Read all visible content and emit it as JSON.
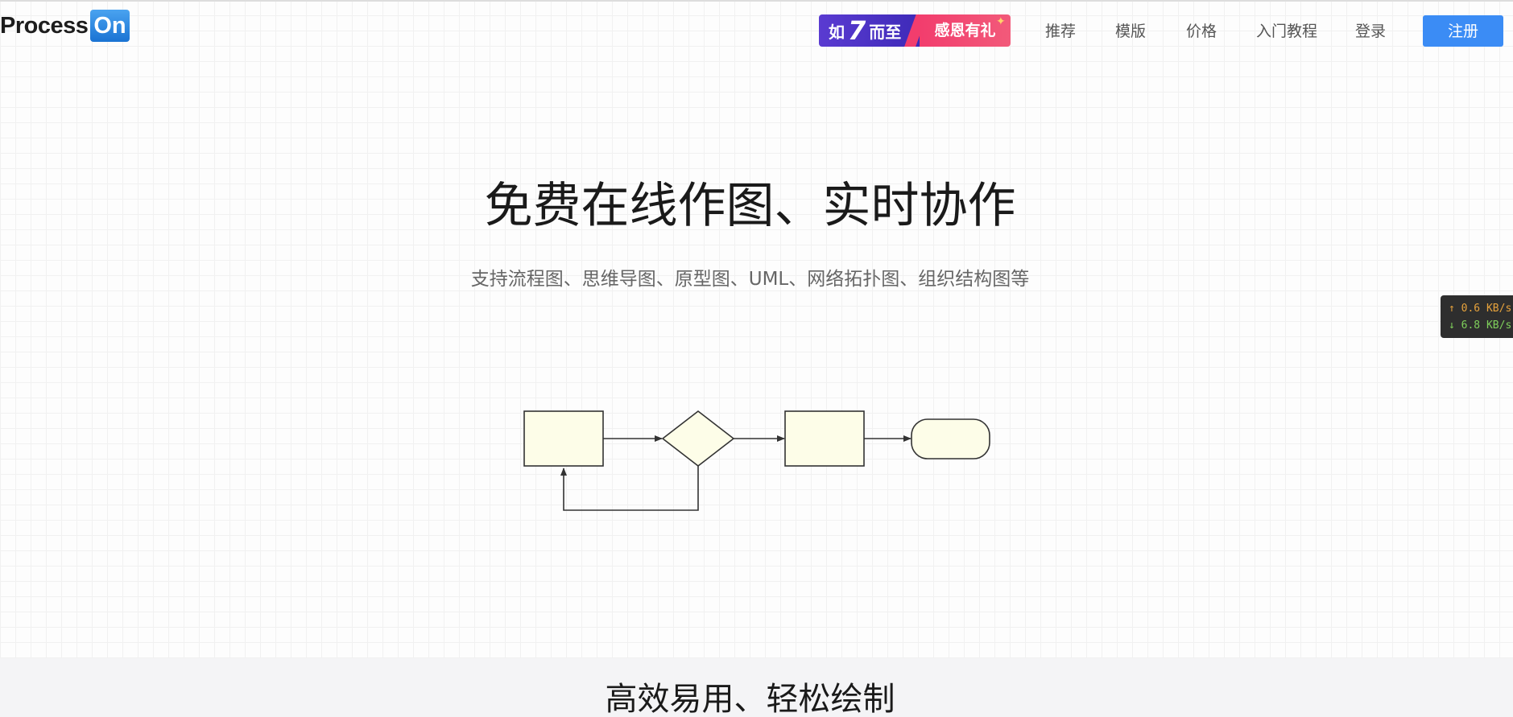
{
  "brand": {
    "logo_text": "Process",
    "logo_badge": "On"
  },
  "promo": {
    "text_left_a": "如",
    "text_left_num": "7",
    "text_left_b": "而至",
    "text_right": "感恩有礼",
    "spark": "✦"
  },
  "nav": {
    "recommend": "推荐",
    "templates": "模版",
    "pricing": "价格",
    "tutorial": "入门教程",
    "login": "登录",
    "register": "注册"
  },
  "hero": {
    "title": "免费在线作图、实时协作",
    "subtitle": "支持流程图、思维导图、原型图、UML、网络拓扑图、组织结构图等"
  },
  "net_speed": {
    "up": "↑ 0.6 KB/s",
    "down": "↓ 6.8 KB/s"
  },
  "feature": {
    "title": "高效易用、轻松绘制"
  },
  "colors": {
    "accent": "#3b8cf5",
    "shape_fill": "#fdfde8",
    "shape_stroke": "#333333",
    "promo_purple": "#4a32c4",
    "promo_pink": "#f23d6d"
  }
}
